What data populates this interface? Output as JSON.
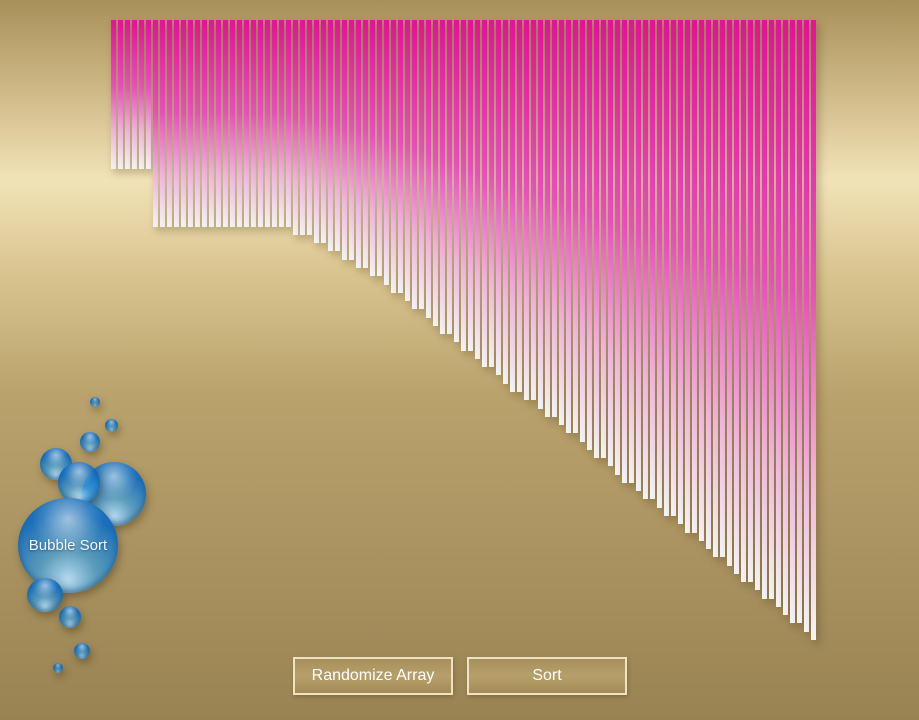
{
  "app": {
    "logo_label": "Bubble Sort"
  },
  "controls": {
    "randomize_label": "Randomize Array",
    "sort_label": "Sort"
  },
  "chart_data": {
    "type": "bar",
    "values": [
      18,
      18,
      18,
      18,
      18,
      18,
      25,
      25,
      25,
      25,
      25,
      25,
      25,
      25,
      25,
      25,
      25,
      25,
      25,
      25,
      25,
      25,
      25,
      25,
      25,
      25,
      26,
      26,
      26,
      27,
      27,
      28,
      28,
      29,
      29,
      30,
      30,
      31,
      31,
      32,
      33,
      33,
      34,
      35,
      35,
      36,
      37,
      38,
      38,
      39,
      40,
      40,
      41,
      42,
      42,
      43,
      44,
      45,
      45,
      46,
      46,
      47,
      48,
      48,
      49,
      50,
      50,
      51,
      52,
      53,
      53,
      54,
      55,
      56,
      56,
      57,
      58,
      58,
      59,
      60,
      60,
      61,
      62,
      62,
      63,
      64,
      65,
      65,
      66,
      67,
      68,
      68,
      69,
      70,
      70,
      71,
      72,
      73,
      73,
      74,
      75
    ],
    "colors": {
      "top": "#e8109e",
      "mid": "#ec4fc0",
      "bottom": "#f4f4f4"
    }
  }
}
